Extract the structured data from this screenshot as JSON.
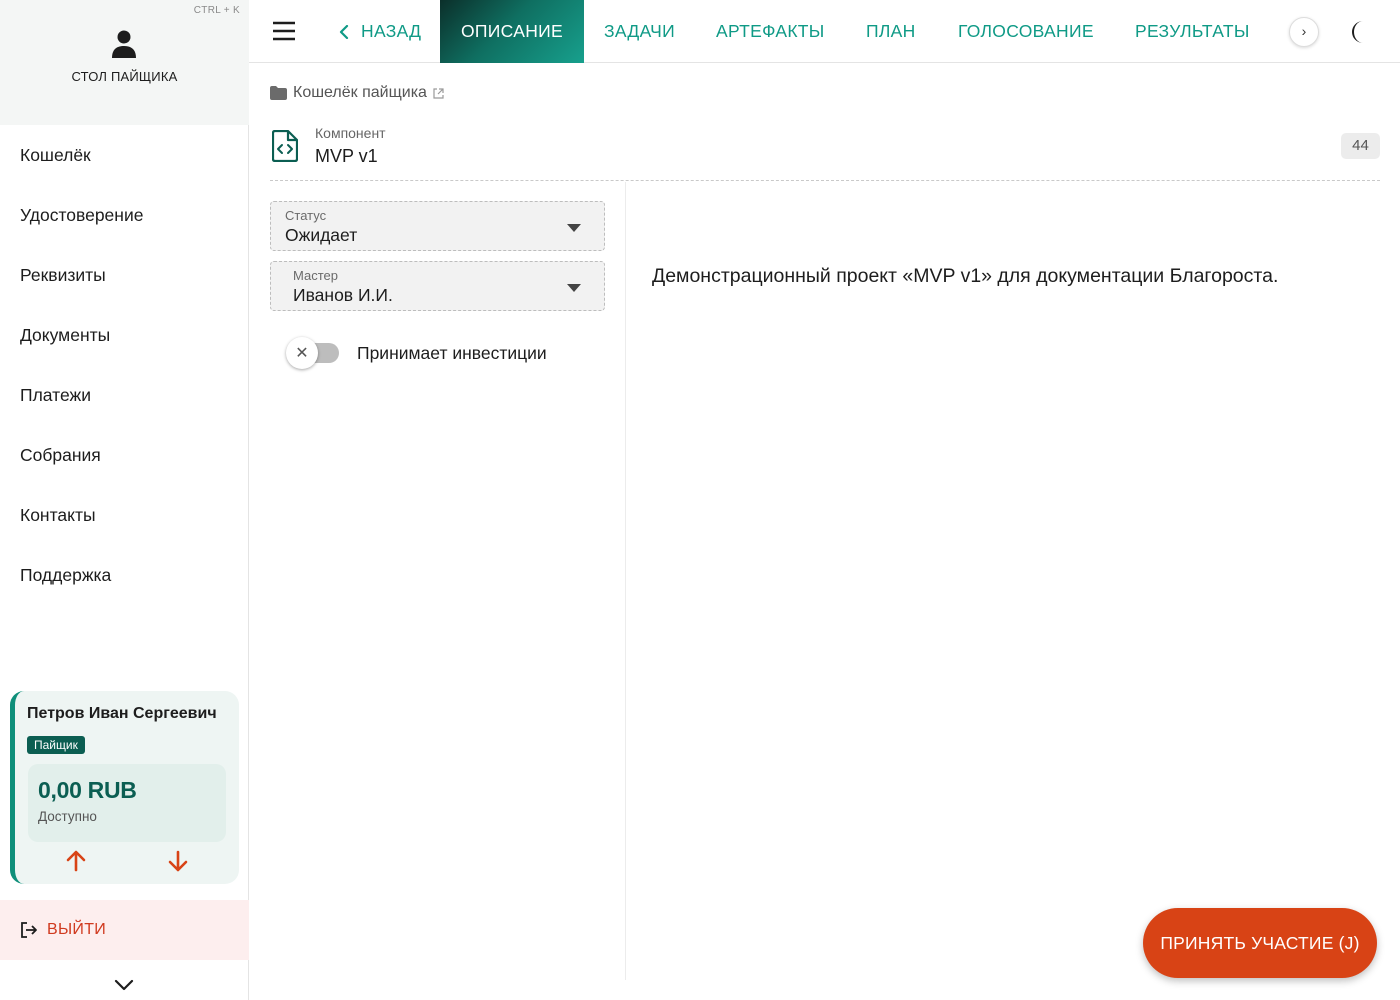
{
  "sidebar": {
    "shortcut_hint": "CTRL + K",
    "title": "СТОЛ ПАЙЩИКА",
    "items": [
      {
        "label": "Кошелёк"
      },
      {
        "label": "Удостоверение"
      },
      {
        "label": "Реквизиты"
      },
      {
        "label": "Документы"
      },
      {
        "label": "Платежи"
      },
      {
        "label": "Собрания"
      },
      {
        "label": "Контакты"
      },
      {
        "label": "Поддержка"
      }
    ],
    "account": {
      "name": "Петров Иван Сергеевич",
      "role": "Пайщик",
      "amount": "0,00 RUB",
      "available_label": "Доступно"
    },
    "logout_label": "ВЫЙТИ"
  },
  "topbar": {
    "back_label": "НАЗАД",
    "tabs": [
      {
        "label": "ОПИСАНИЕ",
        "active": true
      },
      {
        "label": "ЗАДАЧИ"
      },
      {
        "label": "АРТЕФАКТЫ"
      },
      {
        "label": "ПЛАН"
      },
      {
        "label": "ГОЛОСОВАНИЕ"
      },
      {
        "label": "РЕЗУЛЬТАТЫ"
      }
    ],
    "scroll_glyph": "›"
  },
  "content": {
    "breadcrumb": "Кошелёк пайщика",
    "component_type": "Компонент",
    "component_name": "MVP v1",
    "badge": "44",
    "status": {
      "label": "Статус",
      "value": "Ожидает"
    },
    "master": {
      "label": "Мастер",
      "value": "Иванов И.И."
    },
    "toggle": {
      "label": "Принимает инвестиции",
      "on": false,
      "glyph": "✕"
    },
    "description": "Демонстрационный проект «MVP v1» для документации Благороста."
  },
  "cta": {
    "label": "ПРИНЯТЬ УЧАСТИЕ (J)"
  },
  "colors": {
    "accent": "#0f9a86",
    "brand_dark": "#0b5e52",
    "cta": "#d84315",
    "logout": "#d03a1f"
  },
  "icons": [
    "user-icon",
    "arrow-up-icon",
    "arrow-down-icon",
    "logout-icon",
    "chevron-down-icon",
    "menu-icon",
    "chevron-left-icon",
    "chevron-right-icon",
    "moon-icon",
    "folder-icon",
    "external-link-icon",
    "code-file-icon",
    "caret-down-icon",
    "close-icon"
  ]
}
